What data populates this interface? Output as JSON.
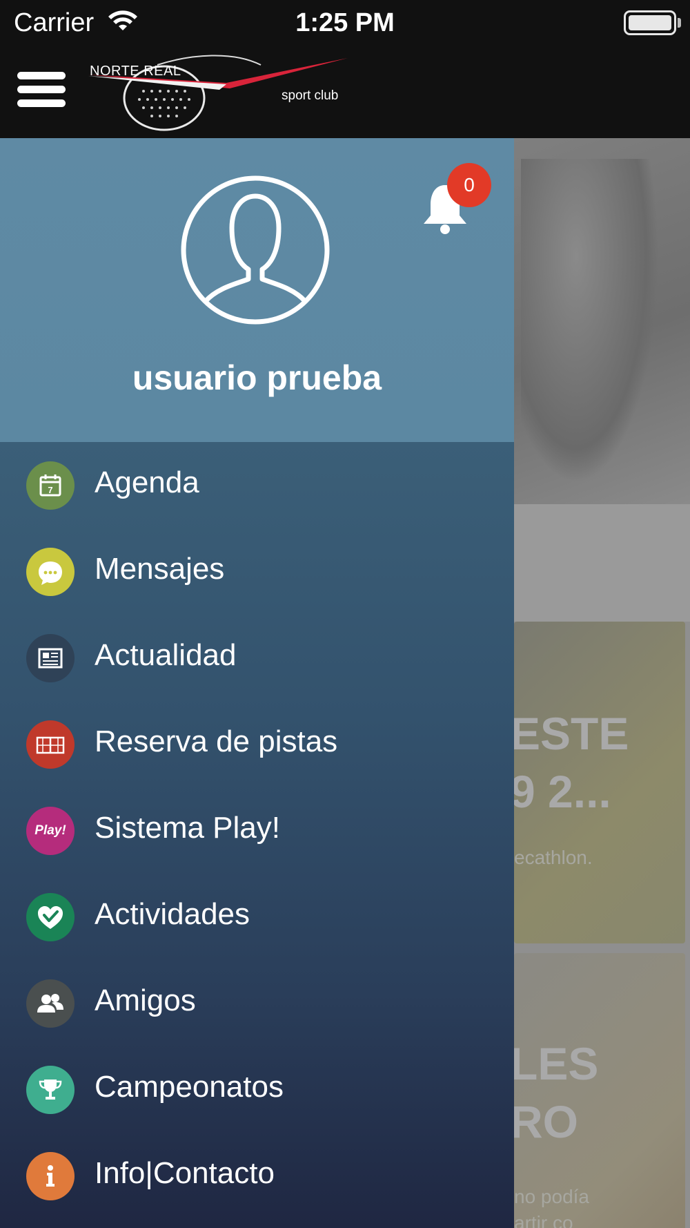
{
  "status_bar": {
    "carrier": "Carrier",
    "time": "1:25 PM"
  },
  "header": {
    "logo_name": "NORTE REAL",
    "logo_tagline": "sport club"
  },
  "profile": {
    "username": "usuario prueba",
    "notification_count": "0"
  },
  "menu": {
    "items": [
      {
        "label": "Agenda",
        "icon": "calendar-icon",
        "color": "#6b8f4b"
      },
      {
        "label": "Mensajes",
        "icon": "chat-bubble-icon",
        "color": "#c9c83e"
      },
      {
        "label": "Actualidad",
        "icon": "newspaper-icon",
        "color": "#2f4257"
      },
      {
        "label": "Reserva de pistas",
        "icon": "court-icon",
        "color": "#c0392b"
      },
      {
        "label": "Sistema Play!",
        "icon": "play-icon",
        "icon_text": "Play!",
        "color": "#b52c7c"
      },
      {
        "label": "Actividades",
        "icon": "check-heart-icon",
        "color": "#1a8456"
      },
      {
        "label": "Amigos",
        "icon": "friends-icon",
        "color": "#4a4f4f"
      },
      {
        "label": "Campeonatos",
        "icon": "trophy-icon",
        "color": "#3fae8f"
      },
      {
        "label": "Info|Contacto",
        "icon": "info-icon",
        "color": "#e07a3b"
      }
    ]
  },
  "background": {
    "card1_title": "ESTE\n9 2...",
    "card1_text": "ecathlon.",
    "card2_title": "LES\nRO",
    "card2_text": "no podía\nartir co"
  }
}
